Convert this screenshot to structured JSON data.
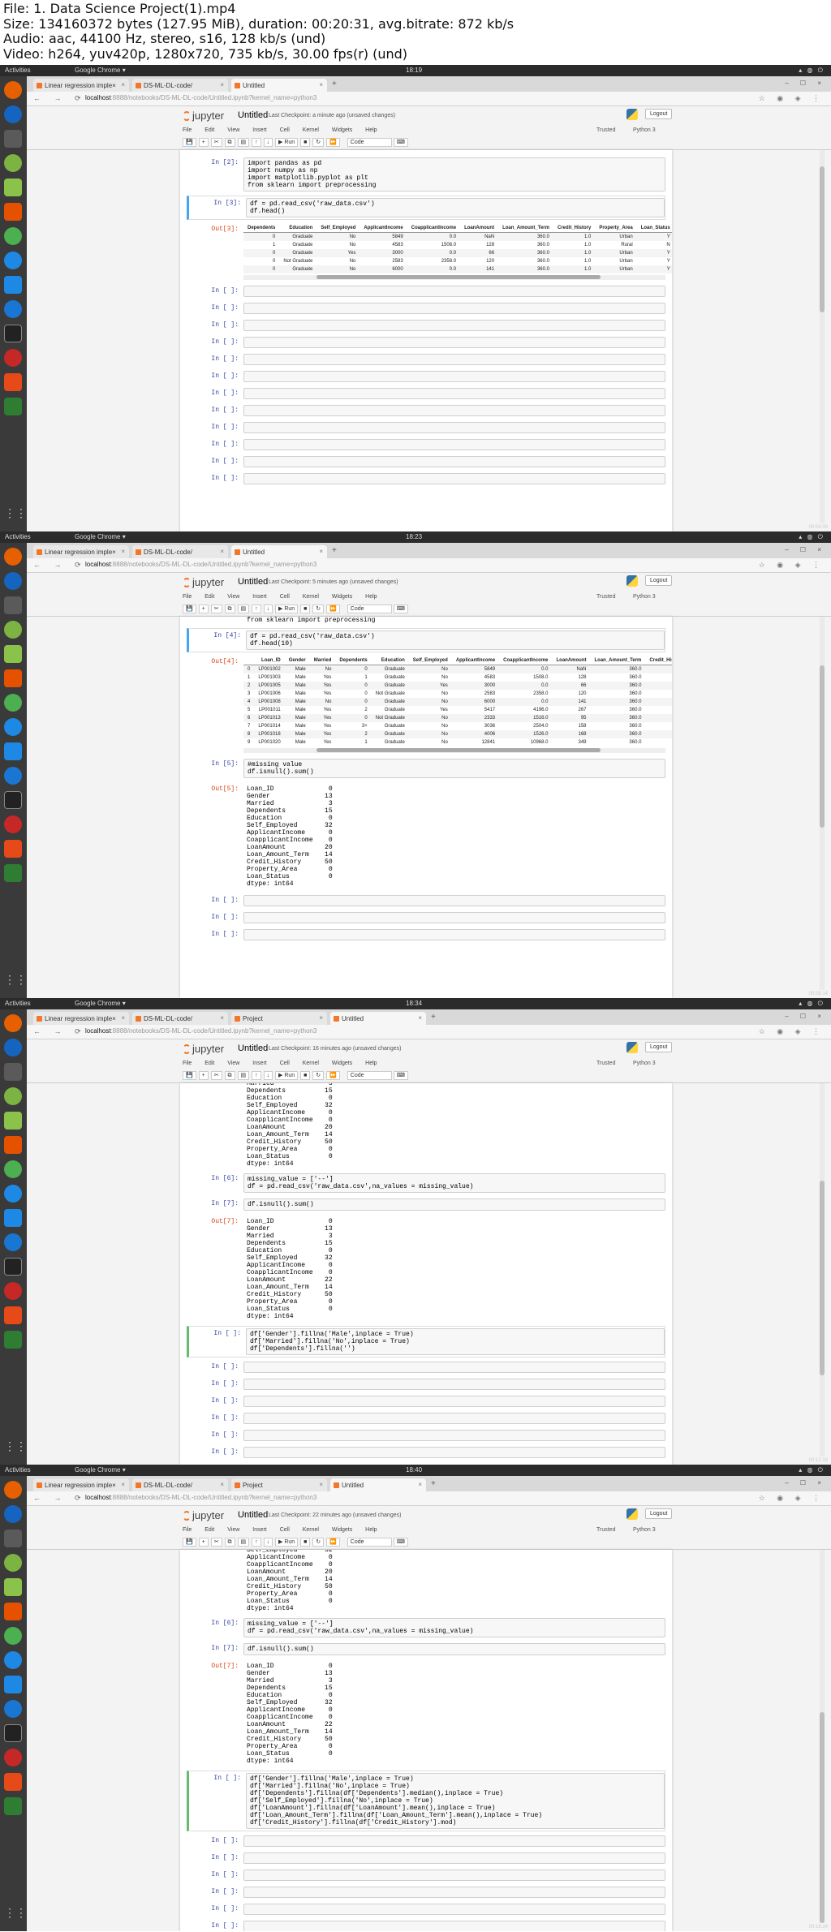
{
  "header": {
    "lines": [
      "File: 1. Data Science Project(1).mp4",
      "Size: 134160372 bytes (127.95 MiB), duration: 00:20:31, avg.bitrate: 872 kb/s",
      "Audio: aac, 44100 Hz, stereo, s16, 128 kb/s (und)",
      "Video: h264, yuv420p, 1280x720, 735 kb/s, 30.00 fps(r) (und)"
    ]
  },
  "common": {
    "topbar_activities": "Activities",
    "topbar_app": "Google Chrome ▾",
    "url_host": "localhost",
    "url_path": ":8888/notebooks/DS-ML-DL-code/Untitled.ipynb?kernel_name=python3",
    "jupyter_name": "jupyter",
    "notebook_title": "Untitled",
    "logout": "Logout",
    "menus": [
      "File",
      "Edit",
      "View",
      "Insert",
      "Cell",
      "Kernel",
      "Widgets",
      "Help"
    ],
    "trusted": "Trusted",
    "kernel": "Python 3",
    "toolbar_run": "▶ Run",
    "cell_type": "Code",
    "empty_prompt": "In [ ]:"
  },
  "frames": [
    {
      "clock": "18:19",
      "tabs": [
        "Linear regression imple×",
        "DS-ML-DL-code/",
        "Untitled"
      ],
      "checkpoint": "Last Checkpoint: a minute ago  (unsaved changes)",
      "cell1_prompt": "In [2]:",
      "cell1_code": "import pandas as pd\nimport numpy as np\nimport matplotlib.pyplot as plt\nfrom sklearn import preprocessing",
      "cell2_prompt": "In [3]:",
      "cell2_code": "df = pd.read_csv('raw_data.csv')\ndf.head()",
      "out_prompt": "Out[3]:",
      "table_headers": [
        "Dependents",
        "Education",
        "Self_Employed",
        "ApplicantIncome",
        "CoapplicantIncome",
        "LoanAmount",
        "Loan_Amount_Term",
        "Credit_History",
        "Property_Area",
        "Loan_Status"
      ],
      "table_rows": [
        [
          "0",
          "Graduate",
          "No",
          "5849",
          "0.0",
          "NaN",
          "360.0",
          "1.0",
          "Urban",
          "Y"
        ],
        [
          "1",
          "Graduate",
          "No",
          "4583",
          "1508.0",
          "128",
          "360.0",
          "1.0",
          "Rural",
          "N"
        ],
        [
          "0",
          "Graduate",
          "Yes",
          "3000",
          "0.0",
          "66",
          "360.0",
          "1.0",
          "Urban",
          "Y"
        ],
        [
          "0",
          "Not Graduate",
          "No",
          "2583",
          "2358.0",
          "120",
          "360.0",
          "1.0",
          "Urban",
          "Y"
        ],
        [
          "0",
          "Graduate",
          "No",
          "6000",
          "0.0",
          "141",
          "360.0",
          "1.0",
          "Urban",
          "Y"
        ]
      ],
      "corner_stamp": "00:04:09"
    },
    {
      "clock": "18:23",
      "tabs": [
        "Linear regression imple×",
        "DS-ML-DL-code/",
        "Untitled"
      ],
      "checkpoint": "Last Checkpoint: 5 minutes ago  (unsaved changes)",
      "clipped_code": "from sklearn import preprocessing",
      "cell1_prompt": "In [4]:",
      "cell1_code": "df = pd.read_csv('raw_data.csv')\ndf.head(10)",
      "out_prompt": "Out[4]:",
      "table_headers": [
        "",
        "Loan_ID",
        "Gender",
        "Married",
        "Dependents",
        "Education",
        "Self_Employed",
        "ApplicantIncome",
        "CoapplicantIncome",
        "LoanAmount",
        "Loan_Amount_Term",
        "Credit_Histo"
      ],
      "table_rows": [
        [
          "0",
          "LP001002",
          "Male",
          "No",
          "0",
          "Graduate",
          "No",
          "5849",
          "0.0",
          "NaN",
          "360.0",
          "1"
        ],
        [
          "1",
          "LP001003",
          "Male",
          "Yes",
          "1",
          "Graduate",
          "No",
          "4583",
          "1508.0",
          "128",
          "360.0",
          "1"
        ],
        [
          "2",
          "LP001005",
          "Male",
          "Yes",
          "0",
          "Graduate",
          "Yes",
          "3000",
          "0.0",
          "66",
          "360.0",
          "1"
        ],
        [
          "3",
          "LP001006",
          "Male",
          "Yes",
          "0",
          "Not Graduate",
          "No",
          "2583",
          "2358.0",
          "120",
          "360.0",
          "1"
        ],
        [
          "4",
          "LP001008",
          "Male",
          "No",
          "0",
          "Graduate",
          "No",
          "6000",
          "0.0",
          "141",
          "360.0",
          "1"
        ],
        [
          "5",
          "LP001011",
          "Male",
          "Yes",
          "2",
          "Graduate",
          "Yes",
          "5417",
          "4196.0",
          "267",
          "360.0",
          "1"
        ],
        [
          "6",
          "LP001013",
          "Male",
          "Yes",
          "0",
          "Not Graduate",
          "No",
          "2333",
          "1516.0",
          "95",
          "360.0",
          "1"
        ],
        [
          "7",
          "LP001014",
          "Male",
          "Yes",
          "3+",
          "Graduate",
          "No",
          "3036",
          "2504.0",
          "158",
          "360.0",
          "0"
        ],
        [
          "8",
          "LP001018",
          "Male",
          "Yes",
          "2",
          "Graduate",
          "No",
          "4006",
          "1526.0",
          "168",
          "360.0",
          "1"
        ],
        [
          "9",
          "LP001020",
          "Male",
          "Yes",
          "1",
          "Graduate",
          "No",
          "12841",
          "10968.0",
          "349",
          "360.0",
          "1"
        ]
      ],
      "cell2_prompt": "In [5]:",
      "cell2_code": "#missing value\ndf.isnull().sum()",
      "out2_prompt": "Out[5]:",
      "out2_text": "Loan_ID              0\nGender              13\nMarried              3\nDependents          15\nEducation            0\nSelf_Employed       32\nApplicantIncome      0\nCoapplicantIncome    0\nLoanAmount          20\nLoan_Amount_Term    14\nCredit_History      50\nProperty_Area        0\nLoan_Status          0\ndtype: int64",
      "corner_stamp": "00:08:14"
    },
    {
      "clock": "18:34",
      "tabs": [
        "Linear regression imple×",
        "DS-ML-DL-code/",
        "Project",
        "Untitled"
      ],
      "checkpoint": "Last Checkpoint: 16 minutes ago  (unsaved changes)",
      "clipped_text": "Married              3\nDependents          15\nEducation            0\nSelf_Employed       32\nApplicantIncome      0\nCoapplicantIncome    0\nLoanAmount          20\nLoan_Amount_Term    14\nCredit_History      50\nProperty_Area        0\nLoan_Status          0\ndtype: int64",
      "cell1_prompt": "In [6]:",
      "cell1_code": "missing_value = ['--']\ndf = pd.read_csv('raw_data.csv',na_values = missing_value)",
      "cell2_prompt": "In [7]:",
      "cell2_code": "df.isnull().sum()",
      "out2_prompt": "Out[7]:",
      "out2_text": "Loan_ID              0\nGender              13\nMarried              3\nDependents          15\nEducation            0\nSelf_Employed       32\nApplicantIncome      0\nCoapplicantIncome    0\nLoanAmount          22\nLoan_Amount_Term    14\nCredit_History      50\nProperty_Area        0\nLoan_Status          0\ndtype: int64",
      "cell3_prompt": "In [ ]:",
      "cell3_code": "df['Gender'].fillna('Male',inplace = True)\ndf['Married'].fillna('No',inplace = True)\ndf['Dependents'].fillna('')",
      "corner_stamp": "00:12:19"
    },
    {
      "clock": "18:40",
      "tabs": [
        "Linear regression imple×",
        "DS-ML-DL-code/",
        "Project",
        "Untitled"
      ],
      "checkpoint": "Last Checkpoint: 22 minutes ago  (unsaved changes)",
      "clipped_text": "Self_Employed       32\nApplicantIncome      0\nCoapplicantIncome    0\nLoanAmount          20\nLoan_Amount_Term    14\nCredit_History      50\nProperty_Area        0\nLoan_Status          0\ndtype: int64",
      "cell1_prompt": "In [6]:",
      "cell1_code": "missing_value = ['--']\ndf = pd.read_csv('raw_data.csv',na_values = missing_value)",
      "cell2_prompt": "In [7]:",
      "cell2_code": "df.isnull().sum()",
      "out2_prompt": "Out[7]:",
      "out2_text": "Loan_ID              0\nGender              13\nMarried              3\nDependents          15\nEducation            0\nSelf_Employed       32\nApplicantIncome      0\nCoapplicantIncome    0\nLoanAmount          22\nLoan_Amount_Term    14\nCredit_History      50\nProperty_Area        0\nLoan_Status          0\ndtype: int64",
      "cell3_prompt": "In [ ]:",
      "cell3_code": "df['Gender'].fillna('Male',inplace = True)\ndf['Married'].fillna('No',inplace = True)\ndf['Dependents'].fillna(df['Dependents'].median(),inplace = True)\ndf['Self_Employed'].fillna('No',inplace = True)\ndf['LoanAmount'].fillna(df['LoanAmount'].mean(),inplace = True)\ndf['Loan_Amount_Term'].fillna(df['Loan_Amount_Term'].mean(),inplace = True)\ndf['Credit_History'].fillna(df['Credit_History'].mod)",
      "corner_stamp": "00:16:24"
    }
  ],
  "icon_colors": {
    "firefox": "#e66000",
    "thunderbird": "#1565c0",
    "chrome": "#4caf50",
    "vscode": "#1e88e5",
    "terminal": "#222222",
    "jupyter": "#f37726",
    "python": "#3572a5"
  }
}
